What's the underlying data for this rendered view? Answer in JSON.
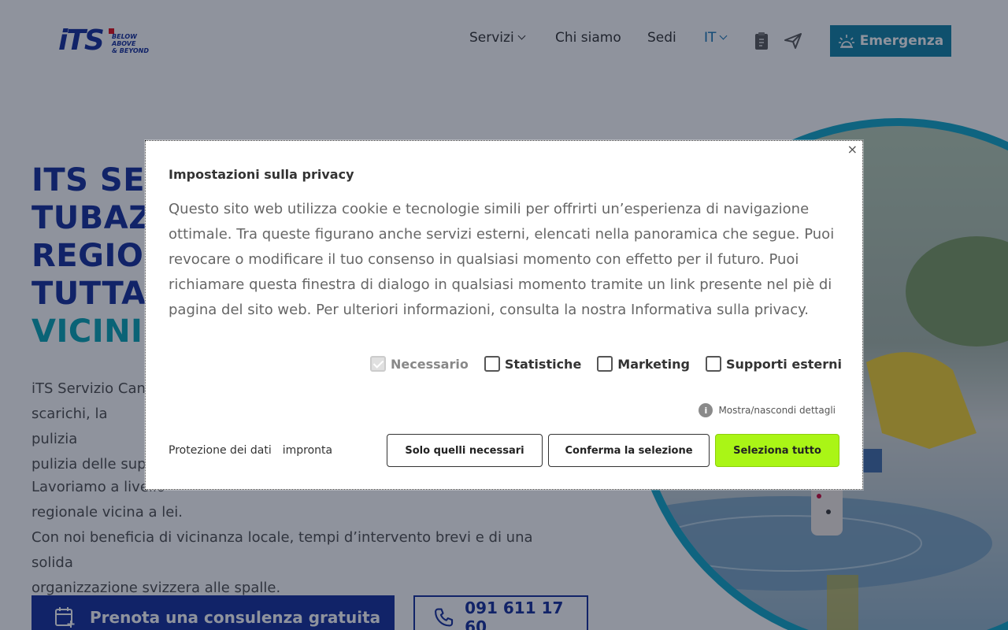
{
  "header": {
    "logo_text": "iTS",
    "logo_tagline": [
      "BELOW",
      "ABOVE",
      "& BEYOND"
    ],
    "nav": [
      {
        "label": "Servizi"
      },
      {
        "label": "Chi siamo"
      },
      {
        "label": "Sedi"
      },
      {
        "label": "IT"
      }
    ],
    "emergency_label": "Emergenza"
  },
  "hero": {
    "title_lines": [
      "ITS SE",
      "TUBAZ",
      "REGIO",
      "TUTTA"
    ],
    "title_accent": "VICINI",
    "paragraph1_lines": [
      "iTS Servizio Cana",
      "scarichi, la pulizia",
      "pulizia delle supe"
    ],
    "paragraph2_lines": [
      "Lavoriamo a livello",
      "regionale vicina a lei.",
      "Con noi beneficia di vicinanza locale, tempi d’intervento brevi e di una solida",
      "organizzazione svizzera alle spalle."
    ],
    "cta_book": "Prenota una consulenza gratuita",
    "cta_phone": "091 611 17 60"
  },
  "modal": {
    "title": "Impostazioni sulla privacy",
    "body": "Questo sito web utilizza cookie e tecnologie simili per offrirti un’esperienza di navigazione ottimale. Tra queste figurano anche servizi esterni, elencati nella panoramica che segue. Puoi revocare o modificare il tuo consenso in qualsiasi momento con effetto per il futuro. Puoi richiamare questa finestra di dialogo in qualsiasi momento tramite un link presente nel piè di pagina del sito web. Per ulteriori informazioni, consulta la nostra Informativa sulla privacy.",
    "options": [
      {
        "label": "Necessario",
        "checked": true,
        "disabled": true
      },
      {
        "label": "Statistiche",
        "checked": false
      },
      {
        "label": "Marketing",
        "checked": false
      },
      {
        "label": "Supporti esterni",
        "checked": false
      }
    ],
    "details_toggle": "Mostra/nascondi dettagli",
    "links": [
      "Protezione dei dati",
      "impronta"
    ],
    "buttons": {
      "only_necessary": "Solo quelli necessari",
      "confirm_selection": "Conferma la selezione",
      "select_all": "Seleziona tutto"
    },
    "close_symbol": "×"
  },
  "colors": {
    "brand_blue": "#0f2a9a",
    "accent_teal": "#00a3b4",
    "emergency_bg": "#0a7fa3",
    "select_all_bg": "#aaf516"
  }
}
